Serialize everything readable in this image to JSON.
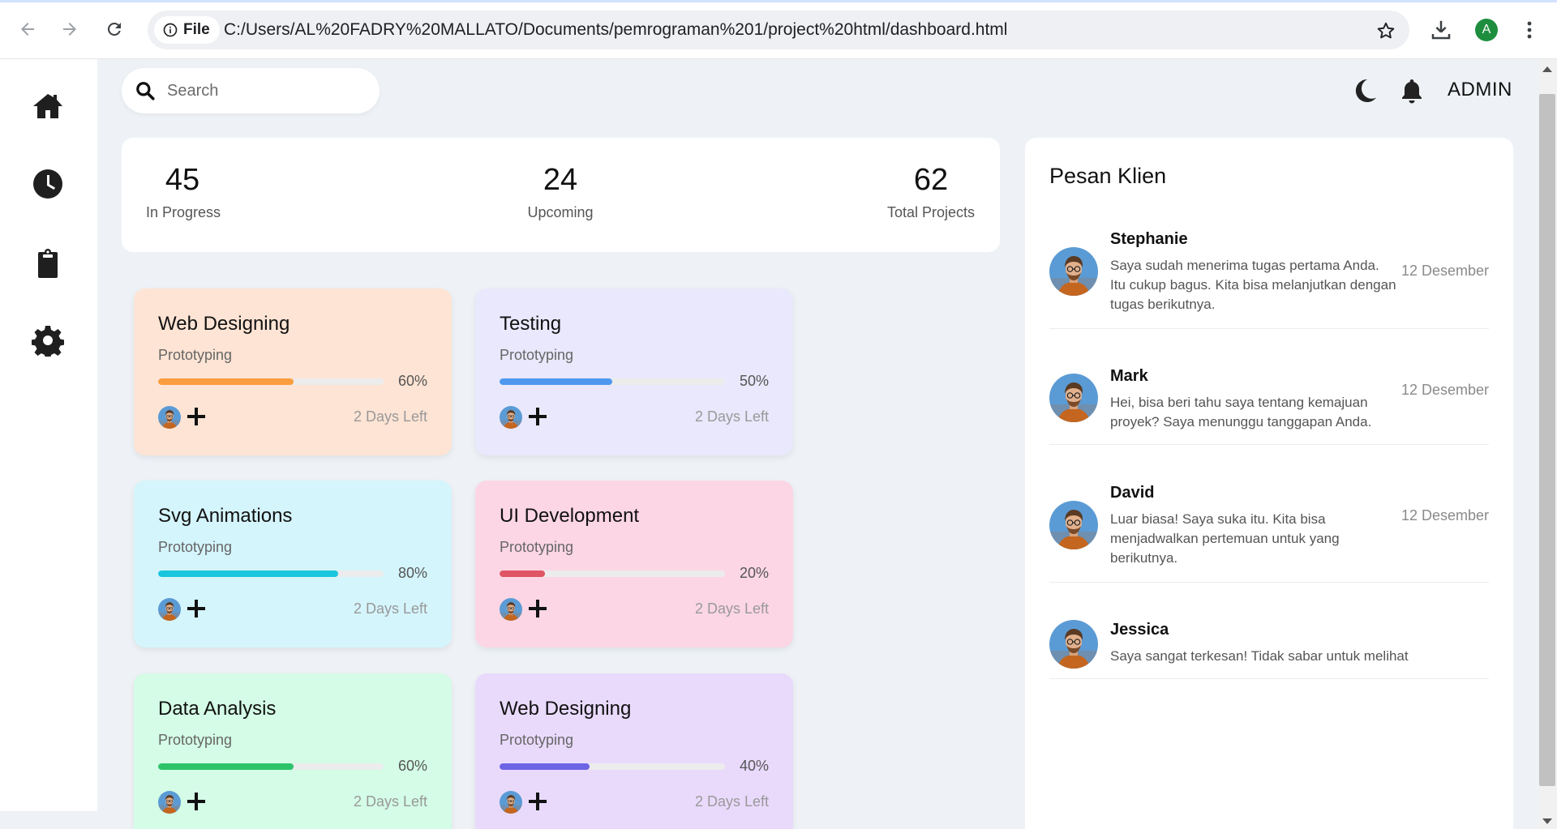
{
  "browser": {
    "file_label": "File",
    "url": "C:/Users/AL%20FADRY%20MALLATO/Documents/pemrograman%201/project%20html/dashboard.html",
    "profile_initial": "A",
    "icons": [
      "back-arrow-icon",
      "forward-arrow-icon",
      "reload-icon",
      "info-icon",
      "star-icon",
      "download-icon",
      "kebab-menu-icon"
    ]
  },
  "sidebar": {
    "items": [
      {
        "icon": "home-icon"
      },
      {
        "icon": "clock-icon"
      },
      {
        "icon": "clipboard-icon"
      },
      {
        "icon": "gear-icon"
      }
    ]
  },
  "topbar": {
    "search_placeholder": "Search",
    "user_label": "ADMIN",
    "icons": [
      "search-icon",
      "moon-icon",
      "bell-icon"
    ]
  },
  "stats": [
    {
      "value": "45",
      "label": "In Progress"
    },
    {
      "value": "24",
      "label": "Upcoming"
    },
    {
      "value": "62",
      "label": "Total Projects"
    }
  ],
  "projects": [
    {
      "title": "Web Designing",
      "subtitle": "Prototyping",
      "progress_label": "60%",
      "progress": 0.6,
      "days_left": "2 Days Left",
      "bg": "#fee4d4",
      "bar": "#fc9d3f"
    },
    {
      "title": "Testing",
      "subtitle": "Prototyping",
      "progress_label": "50%",
      "progress": 0.5,
      "days_left": "2 Days Left",
      "bg": "#e9e8fc",
      "bar": "#4e98f0"
    },
    {
      "title": "Svg Animations",
      "subtitle": "Prototyping",
      "progress_label": "80%",
      "progress": 0.8,
      "days_left": "2 Days Left",
      "bg": "#d4f5fc",
      "bar": "#19c6dd"
    },
    {
      "title": "UI Development",
      "subtitle": "Prototyping",
      "progress_label": "20%",
      "progress": 0.2,
      "days_left": "2 Days Left",
      "bg": "#fcd6e5",
      "bar": "#e05565"
    },
    {
      "title": "Data Analysis",
      "subtitle": "Prototyping",
      "progress_label": "60%",
      "progress": 0.6,
      "days_left": "2 Days Left",
      "bg": "#d4fce6",
      "bar": "#2cc46a"
    },
    {
      "title": "Web Designing",
      "subtitle": "Prototyping",
      "progress_label": "40%",
      "progress": 0.4,
      "days_left": "2 Days Left",
      "bg": "#e9dafc",
      "bar": "#6c63e5"
    }
  ],
  "messages_panel": {
    "title": "Pesan Klien",
    "messages": [
      {
        "name": "Stephanie",
        "text": "Saya sudah menerima tugas pertama Anda. Itu cukup bagus. Kita bisa melanjutkan dengan tugas berikutnya.",
        "date": "12 Desember"
      },
      {
        "name": "Mark",
        "text": "Hei, bisa beri tahu saya tentang kemajuan proyek? Saya menunggu tanggapan Anda.",
        "date": "12 Desember"
      },
      {
        "name": "David",
        "text": "Luar biasa! Saya suka itu. Kita bisa menjadwalkan pertemuan untuk yang berikutnya.",
        "date": "12 Desember"
      },
      {
        "name": "Jessica",
        "text": "Saya sangat terkesan! Tidak sabar untuk melihat",
        "date": ""
      }
    ]
  }
}
